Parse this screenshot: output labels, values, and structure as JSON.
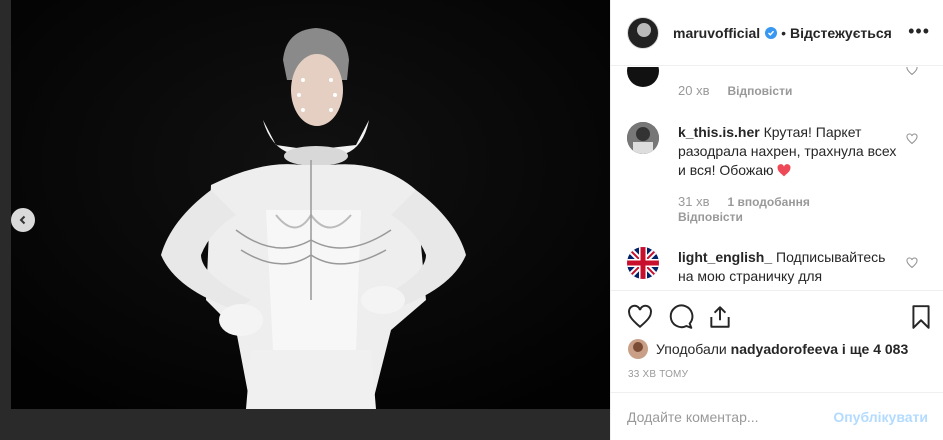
{
  "post": {
    "author": "maruvofficial",
    "follow_status": "Відстежується",
    "more_label": "•••"
  },
  "comments": [
    {
      "time": "20 хв",
      "reply_label": "Відповісти"
    },
    {
      "username": "k_this.is.her",
      "text": "Крутая! Паркет разодрала нахрен, трахнула всех и вся! Обожаю",
      "time": "31 хв",
      "likes": "1 вподобання",
      "reply_label": "Відповісти"
    },
    {
      "username": "light_english_",
      "text": "Подписывайтесь на мою страничку для"
    }
  ],
  "likes": {
    "prefix": "Уподобали",
    "user": "nadyadorofeeva",
    "and_more": "і ще 4 083"
  },
  "timestamp": "33 ХВ ТОМУ",
  "add_comment": {
    "placeholder": "Додайте коментар...",
    "post_label": "Опублікувати"
  },
  "colors": {
    "accent_blue": "#3897f0",
    "heart_red": "#ed4956",
    "post_disabled": "#b3dbff"
  }
}
